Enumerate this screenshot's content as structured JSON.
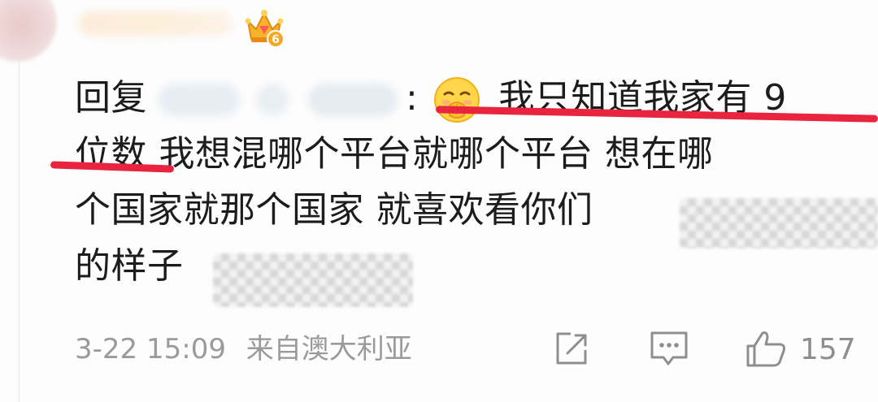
{
  "comment": {
    "reply_prefix": "回复",
    "colon": ":",
    "line1_text": "我只知道我家有 9",
    "line2_underlined": "位数",
    "line2_rest": " 我想混哪个平台就哪个平台 想在哪",
    "line3_text": "个国家就那个国家 就喜欢看你们",
    "line4_text": "的样子"
  },
  "badge": {
    "icon": "crown-badge-icon",
    "level": "6",
    "color": "#f2a51e"
  },
  "footer": {
    "timestamp": "3-22 15:09",
    "source": "来自澳大利亚"
  },
  "actions": {
    "share_icon": "share-icon",
    "comment_icon": "comment-icon",
    "like_icon": "thumbs-up-icon",
    "like_count": "157"
  },
  "colors": {
    "highlight_underline": "#e8243f",
    "meta_text": "#9a9a9a"
  }
}
